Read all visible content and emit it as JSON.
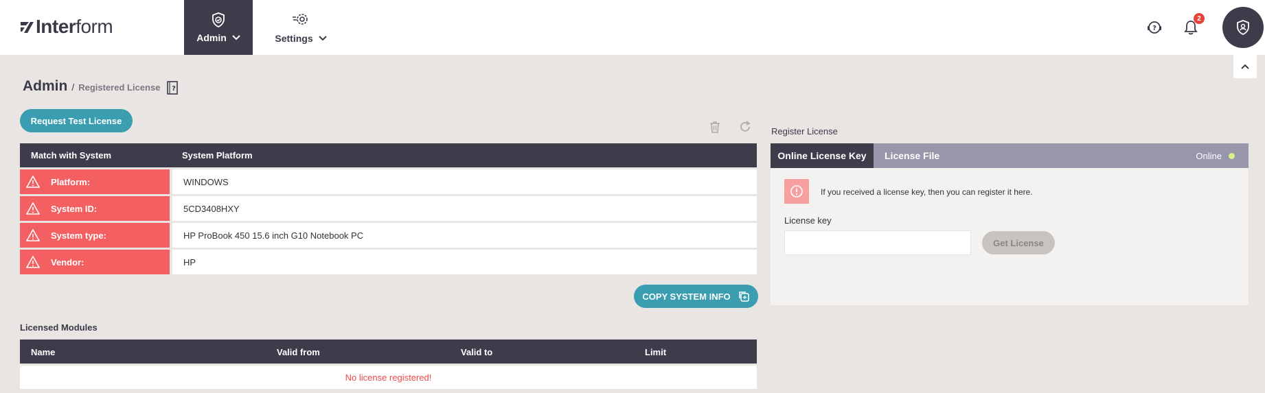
{
  "brand": {
    "bold": "Inter",
    "light": "form"
  },
  "nav": {
    "admin_label": "Admin",
    "settings_label": "Settings"
  },
  "topbar": {
    "notification_count": "2"
  },
  "breadcrumb": {
    "root": "Admin",
    "separator": "/",
    "current": "Registered License"
  },
  "actions": {
    "request_test_license": "Request Test License",
    "copy_system_info": "COPY SYSTEM INFO"
  },
  "system_table": {
    "headers": [
      "Match with System",
      "System Platform"
    ],
    "rows": [
      {
        "label": "Platform:",
        "value": "WINDOWS"
      },
      {
        "label": "System ID:",
        "value": "5CD3408HXY"
      },
      {
        "label": "System type:",
        "value": "HP ProBook 450 15.6 inch G10 Notebook PC"
      },
      {
        "label": "Vendor:",
        "value": "HP"
      }
    ]
  },
  "modules": {
    "title": "Licensed Modules",
    "headers": [
      "Name",
      "Valid from",
      "Valid to",
      "Limit"
    ],
    "empty_message": "No license registered!"
  },
  "register": {
    "title": "Register License",
    "tabs": [
      "Online License Key",
      "License File"
    ],
    "status": "Online",
    "info": "If you received a license key, then you can register it here.",
    "field_label": "License key",
    "input_value": "",
    "button": "Get License"
  },
  "colors": {
    "dark": "#3d3c4a",
    "teal": "#3a9db0",
    "warning": "#f45f61",
    "tab_bar": "#9896ab",
    "online_dot": "#d7ef8c",
    "error_text": "#f04848"
  }
}
